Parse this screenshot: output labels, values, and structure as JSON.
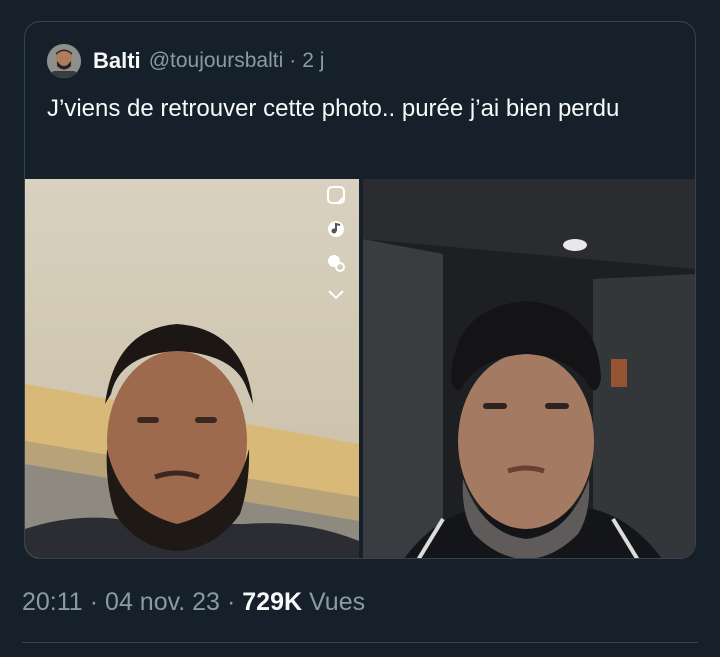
{
  "quoted_tweet": {
    "author_name": "Balti",
    "handle": "@toujoursbalti",
    "separator": "·",
    "age": "2 j",
    "text": "J’viens de retrouver cette photo.. purée j’ai bien perdu"
  },
  "snap_icons": [
    "sticker-icon",
    "music-icon",
    "emoji-icon",
    "chevron-down-icon"
  ],
  "tweet_meta": {
    "time": "20:11",
    "separator": "·",
    "date": "04 nov. 23",
    "views_count": "729K",
    "views_label": "Vues"
  },
  "colors": {
    "background": "#15202b",
    "border": "#38444d",
    "secondary_text": "#8b98a5",
    "primary_text": "#f7f9f9"
  }
}
